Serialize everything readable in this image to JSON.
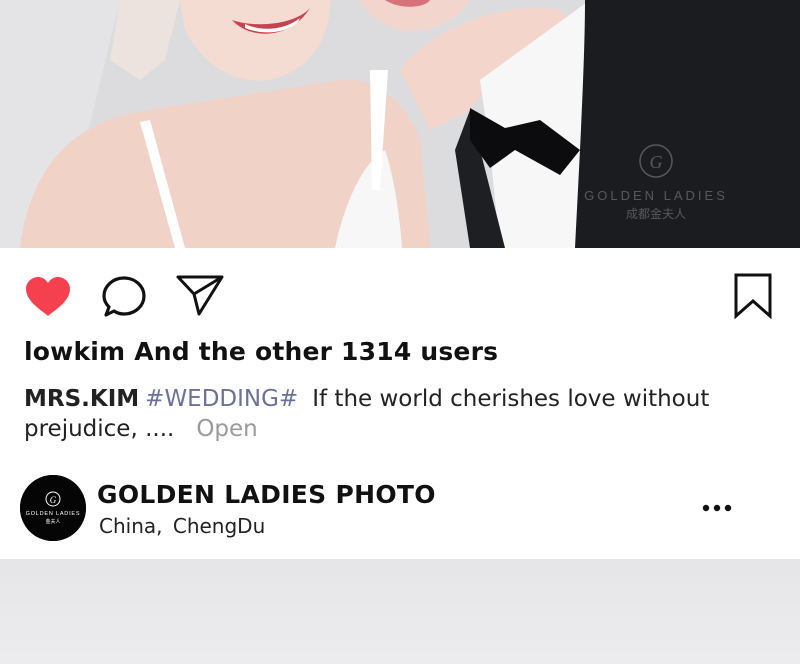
{
  "post": {
    "watermark": {
      "logo_letter": "G",
      "brand": "GOLDEN LADIES",
      "chinese": "成都金夫人"
    },
    "actions": {
      "like_icon": "heart-filled-icon",
      "comment_icon": "comment-bubble-icon",
      "share_icon": "paper-plane-icon",
      "save_icon": "bookmark-icon",
      "like_color": "#f5404f"
    },
    "likes_text": "lowkim And the other 1314 users",
    "caption": {
      "user": "MRS.KIM",
      "hashtag": "#WEDDING#",
      "text_line1": "If the world cherishes love without",
      "text_line2": "prejudice, ....",
      "open_label": "Open"
    },
    "account": {
      "name": "GOLDEN LADIES PHOTO",
      "location_country": "China,",
      "location_city": "ChengDu",
      "avatar_logo_letter": "G",
      "avatar_brand": "GOLDEN LADIES",
      "avatar_chinese": "金夫人",
      "more_icon": "more-horizontal-icon"
    }
  }
}
